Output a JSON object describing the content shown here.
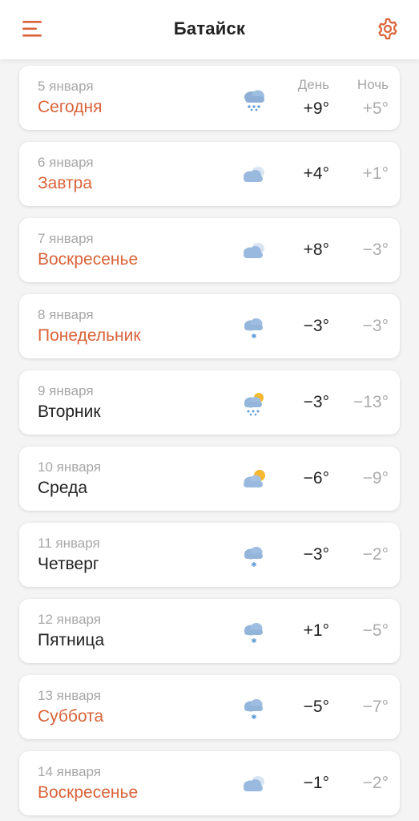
{
  "header": {
    "city": "Батайск"
  },
  "columns": {
    "day": "День",
    "night": "Ночь"
  },
  "colors": {
    "accent": "#d9633a",
    "muted": "#a7a7a7",
    "text": "#222222"
  },
  "days": [
    {
      "date": "5 января",
      "name": "Сегодня",
      "weekend": true,
      "icon": "cloud-rain-icon",
      "day_temp": "+9°",
      "night_temp": "+5°"
    },
    {
      "date": "6 января",
      "name": "Завтра",
      "weekend": true,
      "icon": "overcast-icon",
      "day_temp": "+4°",
      "night_temp": "+1°"
    },
    {
      "date": "7 января",
      "name": "Воскресенье",
      "weekend": true,
      "icon": "overcast-icon",
      "day_temp": "+8°",
      "night_temp": "−3°"
    },
    {
      "date": "8 января",
      "name": "Понедельник",
      "weekend": true,
      "icon": "cloud-snow-light-icon",
      "day_temp": "−3°",
      "night_temp": "−3°"
    },
    {
      "date": "9 января",
      "name": "Вторник",
      "weekend": false,
      "icon": "sun-cloud-snow-icon",
      "day_temp": "−3°",
      "night_temp": "−13°"
    },
    {
      "date": "10 января",
      "name": "Среда",
      "weekend": false,
      "icon": "partly-cloudy-icon",
      "day_temp": "−6°",
      "night_temp": "−9°"
    },
    {
      "date": "11 января",
      "name": "Четверг",
      "weekend": false,
      "icon": "cloud-snow-light-icon",
      "day_temp": "−3°",
      "night_temp": "−2°"
    },
    {
      "date": "12 января",
      "name": "Пятница",
      "weekend": false,
      "icon": "cloud-snow-light-icon",
      "day_temp": "+1°",
      "night_temp": "−5°"
    },
    {
      "date": "13 января",
      "name": "Суббота",
      "weekend": true,
      "icon": "cloud-snow-light-icon",
      "day_temp": "−5°",
      "night_temp": "−7°"
    },
    {
      "date": "14 января",
      "name": "Воскресенье",
      "weekend": true,
      "icon": "overcast-icon",
      "day_temp": "−1°",
      "night_temp": "−2°"
    }
  ]
}
